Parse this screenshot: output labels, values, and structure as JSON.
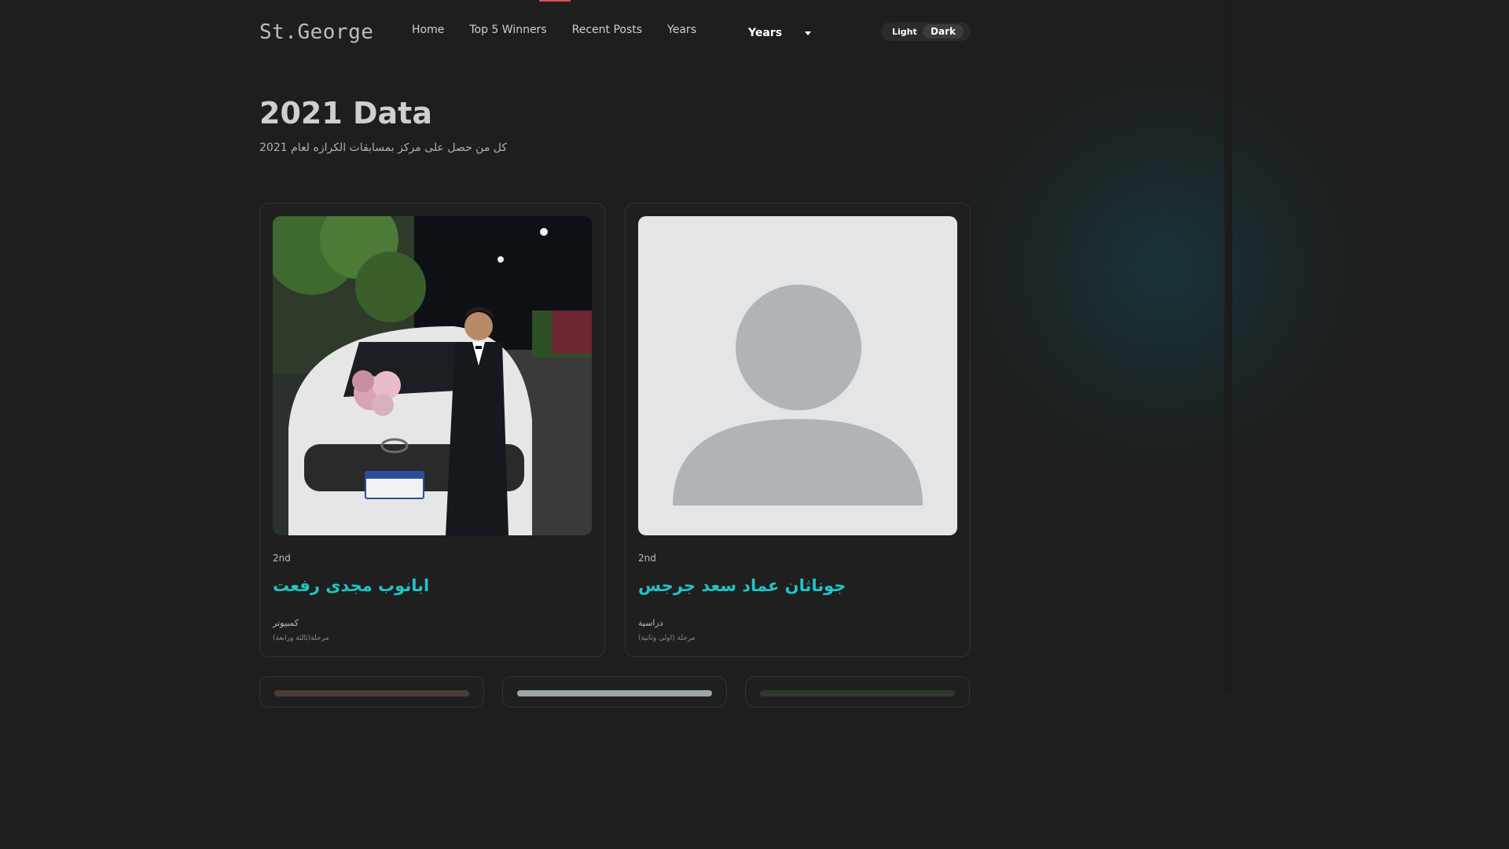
{
  "brand": "St.George",
  "nav": {
    "home": "Home",
    "top5": "Top 5 Winners",
    "recent": "Recent Posts",
    "years": "Years"
  },
  "years_select": {
    "label": "Years"
  },
  "theme": {
    "light": "Light",
    "dark": "Dark",
    "active": "Dark"
  },
  "page": {
    "title": "2021 Data",
    "subtitle": "كل من حصل على مركز بمسابقات الكرازه لعام 2021"
  },
  "cards": [
    {
      "rank": "2nd",
      "name": "ابانوب مجدى رفعت",
      "subject": "كمبيوتر",
      "stage": "مرحلة(ثالثة ورابعة)",
      "image": "photo-boy-with-car"
    },
    {
      "rank": "2nd",
      "name": "جوناثان عماد سعد جرجس",
      "subject": "دراسية",
      "stage": "مرحلة (اولى وثانية)",
      "image": "avatar-placeholder"
    }
  ],
  "colors": {
    "background": "#1e1e1e",
    "accent_name": "#20c5c5",
    "indicator": "#d9534f"
  }
}
